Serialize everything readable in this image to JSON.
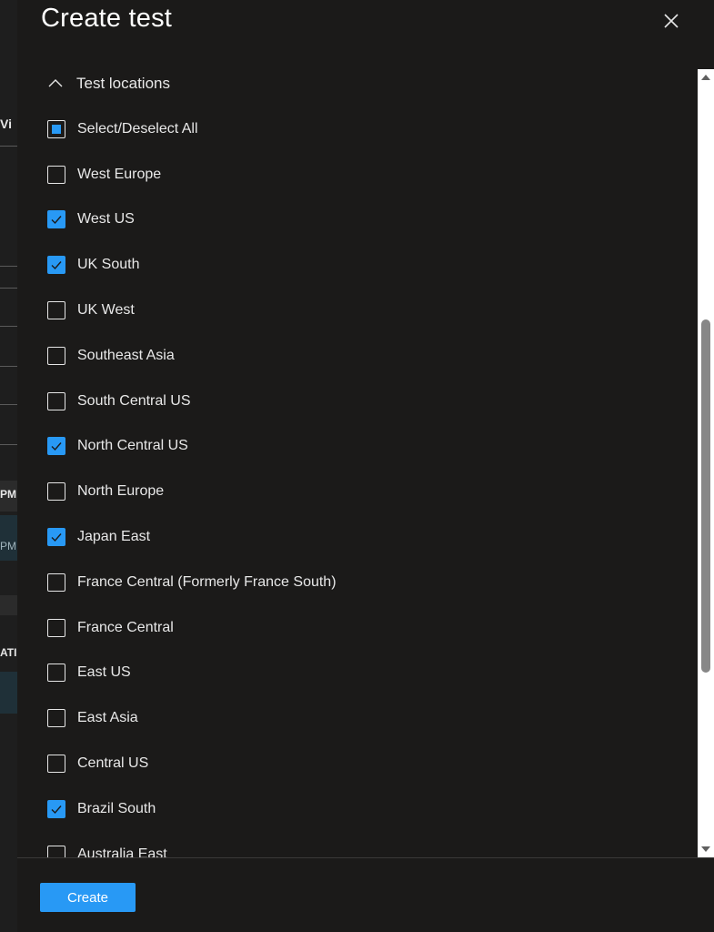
{
  "background": {
    "fragments": [
      "Vi",
      "PM",
      "PM",
      "ATIO"
    ]
  },
  "panel": {
    "title": "Create test",
    "close_icon": "close-icon",
    "section": {
      "label": "Test locations",
      "icon": "chevron-up-icon"
    },
    "select_all": {
      "label": "Select/Deselect All",
      "state": "mixed"
    },
    "locations": [
      {
        "label": "West Europe",
        "checked": false
      },
      {
        "label": "West US",
        "checked": true
      },
      {
        "label": "UK South",
        "checked": true
      },
      {
        "label": "UK West",
        "checked": false
      },
      {
        "label": "Southeast Asia",
        "checked": false
      },
      {
        "label": "South Central US",
        "checked": false
      },
      {
        "label": "North Central US",
        "checked": true
      },
      {
        "label": "North Europe",
        "checked": false
      },
      {
        "label": "Japan East",
        "checked": true
      },
      {
        "label": "France Central (Formerly France South)",
        "checked": false
      },
      {
        "label": "France Central",
        "checked": false
      },
      {
        "label": "East US",
        "checked": false
      },
      {
        "label": "East Asia",
        "checked": false
      },
      {
        "label": "Central US",
        "checked": false
      },
      {
        "label": "Brazil South",
        "checked": true
      },
      {
        "label": "Australia East",
        "checked": false
      }
    ],
    "create_label": "Create"
  },
  "colors": {
    "accent": "#2899f5",
    "panel_bg": "#1b1a19"
  }
}
